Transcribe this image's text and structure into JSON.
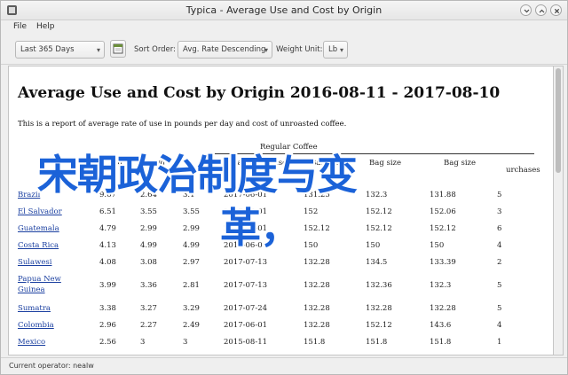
{
  "window": {
    "title": "Typica - Average Use and Cost by Origin"
  },
  "menu": {
    "file": "File",
    "help": "Help"
  },
  "toolbar": {
    "date_range": "Last 365 Days",
    "sort_order_label": "Sort Order:",
    "sort_order_value": "Avg. Rate Descending",
    "weight_unit_label": "Weight Unit:",
    "weight_unit_value": "Lb"
  },
  "report": {
    "title": "Average Use and Cost by Origin 2016-08-11 - 2017-08-10",
    "description": "This is a report of average rate of use in pounds per day and cost of unroasted coffee.",
    "header_top_partial": "Regular Coffee",
    "columns": {
      "c2_partial": "Avg",
      "c3_partial": "Avg",
      "c5": "Last Purchase",
      "c5_sub": "Date",
      "c7": "Bag size",
      "c8": "Bag size",
      "c9": "Bag size",
      "c10_partial": "urchases"
    },
    "rows": [
      {
        "origin": "Brazil",
        "v1": "9.67",
        "v2": "2.64",
        "v3": "3.1",
        "date": "2017-06-01",
        "b1": "131.25",
        "b2": "132.3",
        "b3": "131.88",
        "n": "5"
      },
      {
        "origin": "El Salvador",
        "v1": "6.51",
        "v2": "3.55",
        "v3": "3.55",
        "date": "2017-06-01",
        "b1": "152",
        "b2": "152.12",
        "b3": "152.06",
        "n": "3"
      },
      {
        "origin": "Guatemala",
        "v1": "4.79",
        "v2": "2.99",
        "v3": "2.99",
        "date": "2017-06-01",
        "b1": "152.12",
        "b2": "152.12",
        "b3": "152.12",
        "n": "6"
      },
      {
        "origin": "Costa Rica",
        "v1": "4.13",
        "v2": "4.99",
        "v3": "4.99",
        "date": "2017-06-01",
        "b1": "150",
        "b2": "150",
        "b3": "150",
        "n": "4"
      },
      {
        "origin": "Sulawesi",
        "v1": "4.08",
        "v2": "3.08",
        "v3": "2.97",
        "date": "2017-07-13",
        "b1": "132.28",
        "b2": "134.5",
        "b3": "133.39",
        "n": "2"
      },
      {
        "origin": "Papua New",
        "origin2": "Guinea",
        "v1": "3.99",
        "v2": "3.36",
        "v3": "2.81",
        "date": "2017-07-13",
        "b1": "132.28",
        "b2": "132.36",
        "b3": "132.3",
        "n": "5"
      },
      {
        "origin": "Sumatra",
        "v1": "3.38",
        "v2": "3.27",
        "v3": "3.29",
        "date": "2017-07-24",
        "b1": "132.28",
        "b2": "132.28",
        "b3": "132.28",
        "n": "5"
      },
      {
        "origin": "Colombia",
        "v1": "2.96",
        "v2": "2.27",
        "v3": "2.49",
        "date": "2017-06-01",
        "b1": "132.28",
        "b2": "152.12",
        "b3": "143.6",
        "n": "4"
      },
      {
        "origin": "Mexico",
        "v1": "2.56",
        "v2": "3",
        "v3": "3",
        "date": "2015-08-11",
        "b1": "151.8",
        "b2": "151.8",
        "b3": "151.8",
        "n": "1"
      }
    ]
  },
  "overlay": {
    "line1": "宋朝政治制度与变",
    "line2": "革，"
  },
  "status": {
    "text": "Current operator: nealw"
  },
  "colors": {
    "overlay": "#1b62d8",
    "link": "#1a3fa0"
  }
}
